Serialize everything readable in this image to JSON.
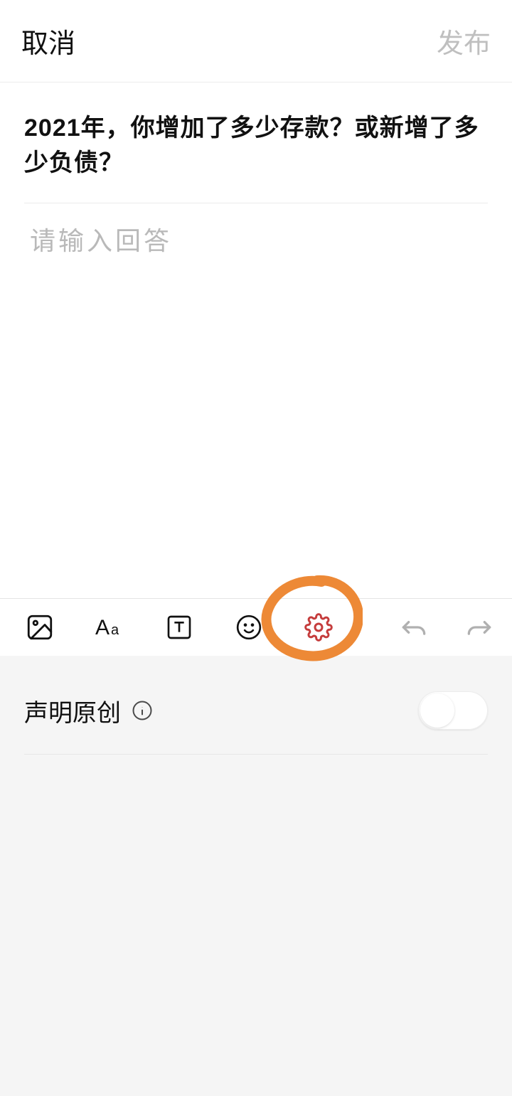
{
  "header": {
    "cancel_label": "取消",
    "publish_label": "发布"
  },
  "question": {
    "text": "2021年，你增加了多少存款？或新增了多少负债？"
  },
  "editor": {
    "placeholder": "请输入回答"
  },
  "toolbar": {
    "icons": {
      "image": "image-icon",
      "text_style": "text-style-icon",
      "text_box": "text-box-icon",
      "emoji": "emoji-icon",
      "settings": "gear-icon",
      "undo": "undo-icon",
      "redo": "redo-icon"
    }
  },
  "settings": {
    "original_label": "声明原创",
    "original_toggle": false
  },
  "annotation": {
    "color": "#ed8936"
  }
}
